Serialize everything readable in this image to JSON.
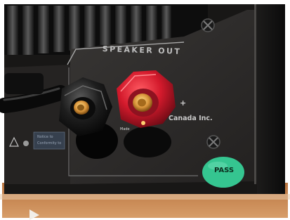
{
  "photo": {
    "panel_label": "SPEAKER OUT",
    "manufacturer_text": "Canada Inc.",
    "made_text": "Made",
    "notice_line_1": "Notice to",
    "notice_line_2": "Conformity to",
    "plus_sign": "+",
    "pass_sticker_text": "PASS",
    "colors": {
      "panel": "#2e2c2b",
      "cabinet": "#141313",
      "red_terminal": "#c8182a",
      "black_terminal": "#1a1a1a",
      "pass_sticker": "#35c590",
      "floor": "#c98a57"
    },
    "objects": [
      "heatsink-fins",
      "red-binding-post",
      "black-binding-post",
      "pass-sticker",
      "mounting-screws",
      "power-cable"
    ]
  }
}
